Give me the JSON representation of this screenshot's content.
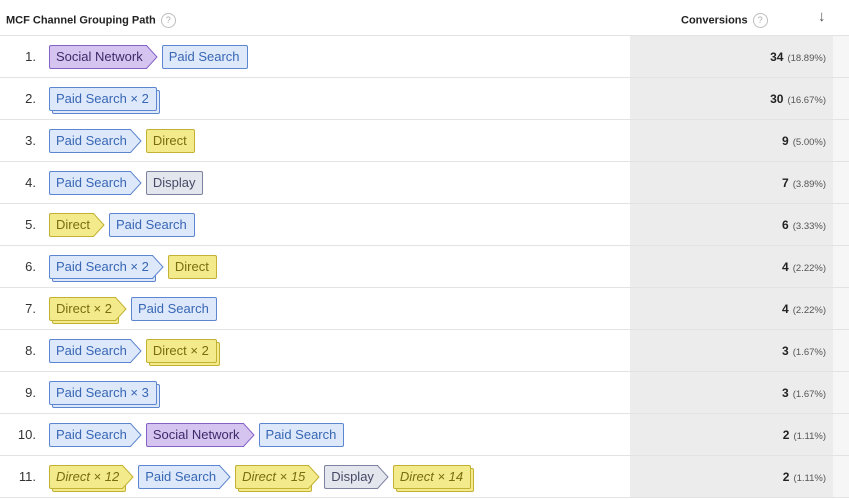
{
  "header": {
    "path_label": "MCF Channel Grouping Path",
    "conversions_label": "Conversions",
    "help_glyph": "?",
    "sort_glyph": "↓"
  },
  "colors": {
    "social_network": "#d5c4ef",
    "paid_search": "#dde8fa",
    "direct": "#f3ea8b",
    "display": "#e4e6ee",
    "value_column": "#ececec"
  },
  "rows": [
    {
      "num": "1.",
      "conversions": "34",
      "percent": "(18.89%)",
      "path": [
        {
          "label": "Social Network",
          "type": "social"
        },
        {
          "label": "Paid Search",
          "type": "paid"
        }
      ]
    },
    {
      "num": "2.",
      "conversions": "30",
      "percent": "(16.67%)",
      "path": [
        {
          "label": "Paid Search × 2",
          "type": "paid"
        }
      ]
    },
    {
      "num": "3.",
      "conversions": "9",
      "percent": "(5.00%)",
      "path": [
        {
          "label": "Paid Search",
          "type": "paid"
        },
        {
          "label": "Direct",
          "type": "direct"
        }
      ]
    },
    {
      "num": "4.",
      "conversions": "7",
      "percent": "(3.89%)",
      "path": [
        {
          "label": "Paid Search",
          "type": "paid"
        },
        {
          "label": "Display",
          "type": "display"
        }
      ]
    },
    {
      "num": "5.",
      "conversions": "6",
      "percent": "(3.33%)",
      "path": [
        {
          "label": "Direct",
          "type": "direct"
        },
        {
          "label": "Paid Search",
          "type": "paid"
        }
      ]
    },
    {
      "num": "6.",
      "conversions": "4",
      "percent": "(2.22%)",
      "path": [
        {
          "label": "Paid Search × 2",
          "type": "paid"
        },
        {
          "label": "Direct",
          "type": "direct"
        }
      ]
    },
    {
      "num": "7.",
      "conversions": "4",
      "percent": "(2.22%)",
      "path": [
        {
          "label": "Direct × 2",
          "type": "direct"
        },
        {
          "label": "Paid Search",
          "type": "paid"
        }
      ]
    },
    {
      "num": "8.",
      "conversions": "3",
      "percent": "(1.67%)",
      "path": [
        {
          "label": "Paid Search",
          "type": "paid"
        },
        {
          "label": "Direct × 2",
          "type": "direct"
        }
      ]
    },
    {
      "num": "9.",
      "conversions": "3",
      "percent": "(1.67%)",
      "path": [
        {
          "label": "Paid Search × 3",
          "type": "paid"
        }
      ]
    },
    {
      "num": "10.",
      "conversions": "2",
      "percent": "(1.11%)",
      "path": [
        {
          "label": "Paid Search",
          "type": "paid"
        },
        {
          "label": "Social Network",
          "type": "social"
        },
        {
          "label": "Paid Search",
          "type": "paid"
        }
      ]
    },
    {
      "num": "11.",
      "conversions": "2",
      "percent": "(1.11%)",
      "path": [
        {
          "label": "Direct × 12",
          "type": "direct",
          "italic": true
        },
        {
          "label": "Paid Search",
          "type": "paid"
        },
        {
          "label": "Direct × 15",
          "type": "direct",
          "italic": true
        },
        {
          "label": "Display",
          "type": "display"
        },
        {
          "label": "Direct × 14",
          "type": "direct",
          "italic": true
        }
      ]
    }
  ]
}
